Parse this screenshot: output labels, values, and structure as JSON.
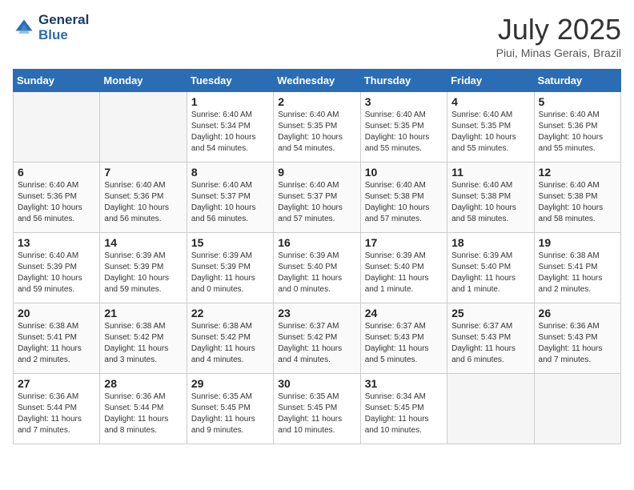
{
  "header": {
    "logo_line1": "General",
    "logo_line2": "Blue",
    "month_year": "July 2025",
    "location": "Piui, Minas Gerais, Brazil"
  },
  "weekdays": [
    "Sunday",
    "Monday",
    "Tuesday",
    "Wednesday",
    "Thursday",
    "Friday",
    "Saturday"
  ],
  "weeks": [
    [
      {
        "day": "",
        "empty": true
      },
      {
        "day": "",
        "empty": true
      },
      {
        "day": "1",
        "sunrise": "6:40 AM",
        "sunset": "5:34 PM",
        "daylight": "10 hours and 54 minutes."
      },
      {
        "day": "2",
        "sunrise": "6:40 AM",
        "sunset": "5:35 PM",
        "daylight": "10 hours and 54 minutes."
      },
      {
        "day": "3",
        "sunrise": "6:40 AM",
        "sunset": "5:35 PM",
        "daylight": "10 hours and 55 minutes."
      },
      {
        "day": "4",
        "sunrise": "6:40 AM",
        "sunset": "5:35 PM",
        "daylight": "10 hours and 55 minutes."
      },
      {
        "day": "5",
        "sunrise": "6:40 AM",
        "sunset": "5:36 PM",
        "daylight": "10 hours and 55 minutes."
      }
    ],
    [
      {
        "day": "6",
        "sunrise": "6:40 AM",
        "sunset": "5:36 PM",
        "daylight": "10 hours and 56 minutes."
      },
      {
        "day": "7",
        "sunrise": "6:40 AM",
        "sunset": "5:36 PM",
        "daylight": "10 hours and 56 minutes."
      },
      {
        "day": "8",
        "sunrise": "6:40 AM",
        "sunset": "5:37 PM",
        "daylight": "10 hours and 56 minutes."
      },
      {
        "day": "9",
        "sunrise": "6:40 AM",
        "sunset": "5:37 PM",
        "daylight": "10 hours and 57 minutes."
      },
      {
        "day": "10",
        "sunrise": "6:40 AM",
        "sunset": "5:38 PM",
        "daylight": "10 hours and 57 minutes."
      },
      {
        "day": "11",
        "sunrise": "6:40 AM",
        "sunset": "5:38 PM",
        "daylight": "10 hours and 58 minutes."
      },
      {
        "day": "12",
        "sunrise": "6:40 AM",
        "sunset": "5:38 PM",
        "daylight": "10 hours and 58 minutes."
      }
    ],
    [
      {
        "day": "13",
        "sunrise": "6:40 AM",
        "sunset": "5:39 PM",
        "daylight": "10 hours and 59 minutes."
      },
      {
        "day": "14",
        "sunrise": "6:39 AM",
        "sunset": "5:39 PM",
        "daylight": "10 hours and 59 minutes."
      },
      {
        "day": "15",
        "sunrise": "6:39 AM",
        "sunset": "5:39 PM",
        "daylight": "11 hours and 0 minutes."
      },
      {
        "day": "16",
        "sunrise": "6:39 AM",
        "sunset": "5:40 PM",
        "daylight": "11 hours and 0 minutes."
      },
      {
        "day": "17",
        "sunrise": "6:39 AM",
        "sunset": "5:40 PM",
        "daylight": "11 hours and 1 minute."
      },
      {
        "day": "18",
        "sunrise": "6:39 AM",
        "sunset": "5:40 PM",
        "daylight": "11 hours and 1 minute."
      },
      {
        "day": "19",
        "sunrise": "6:38 AM",
        "sunset": "5:41 PM",
        "daylight": "11 hours and 2 minutes."
      }
    ],
    [
      {
        "day": "20",
        "sunrise": "6:38 AM",
        "sunset": "5:41 PM",
        "daylight": "11 hours and 2 minutes."
      },
      {
        "day": "21",
        "sunrise": "6:38 AM",
        "sunset": "5:42 PM",
        "daylight": "11 hours and 3 minutes."
      },
      {
        "day": "22",
        "sunrise": "6:38 AM",
        "sunset": "5:42 PM",
        "daylight": "11 hours and 4 minutes."
      },
      {
        "day": "23",
        "sunrise": "6:37 AM",
        "sunset": "5:42 PM",
        "daylight": "11 hours and 4 minutes."
      },
      {
        "day": "24",
        "sunrise": "6:37 AM",
        "sunset": "5:43 PM",
        "daylight": "11 hours and 5 minutes."
      },
      {
        "day": "25",
        "sunrise": "6:37 AM",
        "sunset": "5:43 PM",
        "daylight": "11 hours and 6 minutes."
      },
      {
        "day": "26",
        "sunrise": "6:36 AM",
        "sunset": "5:43 PM",
        "daylight": "11 hours and 7 minutes."
      }
    ],
    [
      {
        "day": "27",
        "sunrise": "6:36 AM",
        "sunset": "5:44 PM",
        "daylight": "11 hours and 7 minutes."
      },
      {
        "day": "28",
        "sunrise": "6:36 AM",
        "sunset": "5:44 PM",
        "daylight": "11 hours and 8 minutes."
      },
      {
        "day": "29",
        "sunrise": "6:35 AM",
        "sunset": "5:45 PM",
        "daylight": "11 hours and 9 minutes."
      },
      {
        "day": "30",
        "sunrise": "6:35 AM",
        "sunset": "5:45 PM",
        "daylight": "11 hours and 10 minutes."
      },
      {
        "day": "31",
        "sunrise": "6:34 AM",
        "sunset": "5:45 PM",
        "daylight": "11 hours and 10 minutes."
      },
      {
        "day": "",
        "empty": true
      },
      {
        "day": "",
        "empty": true
      }
    ]
  ],
  "labels": {
    "sunrise": "Sunrise:",
    "sunset": "Sunset:",
    "daylight": "Daylight:"
  }
}
